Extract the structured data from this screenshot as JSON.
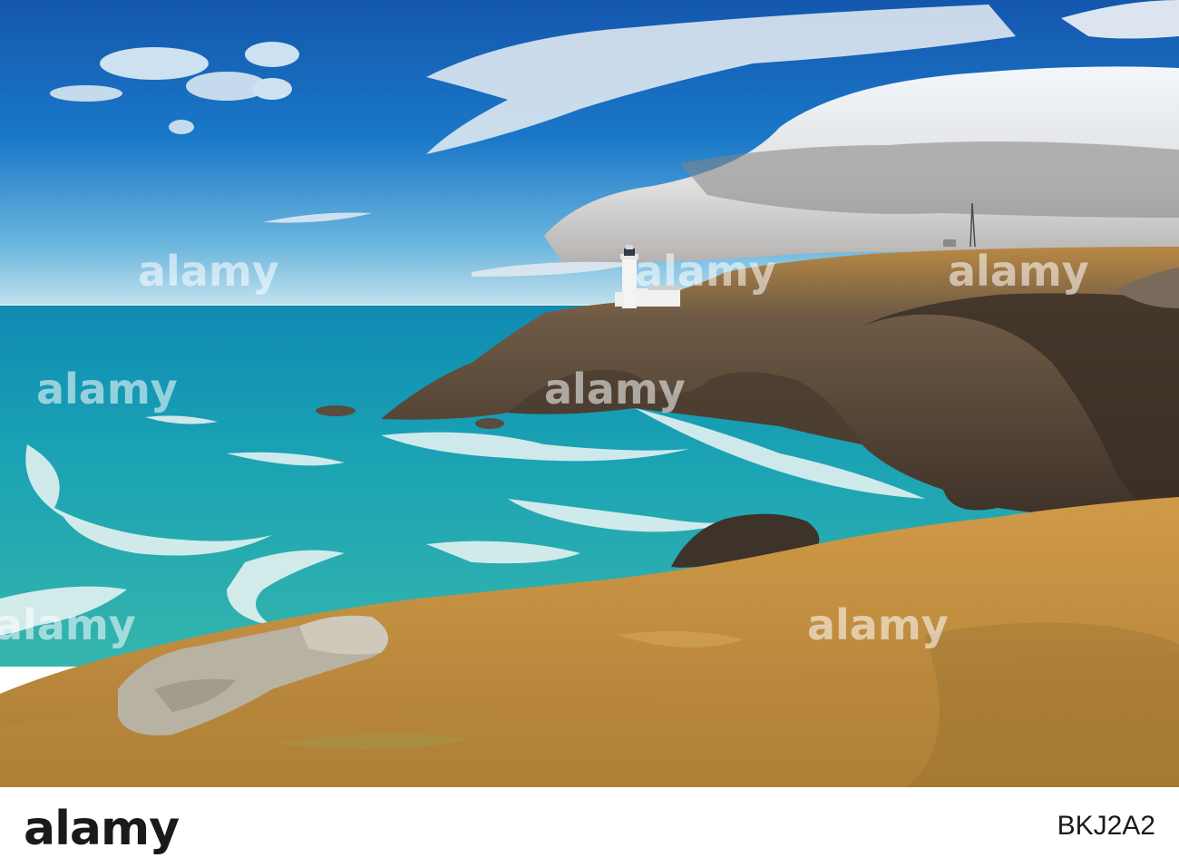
{
  "watermark": {
    "text": "alamy"
  },
  "footer": {
    "logo_text": "alamy",
    "image_id": "BKJ2A2"
  },
  "colors": {
    "sky_top": "#1b63b8",
    "sky_horizon": "#a9d6ea",
    "sea": "#2fa7ae",
    "grass": "#c99a4a",
    "cliff": "#5a4a3a"
  }
}
